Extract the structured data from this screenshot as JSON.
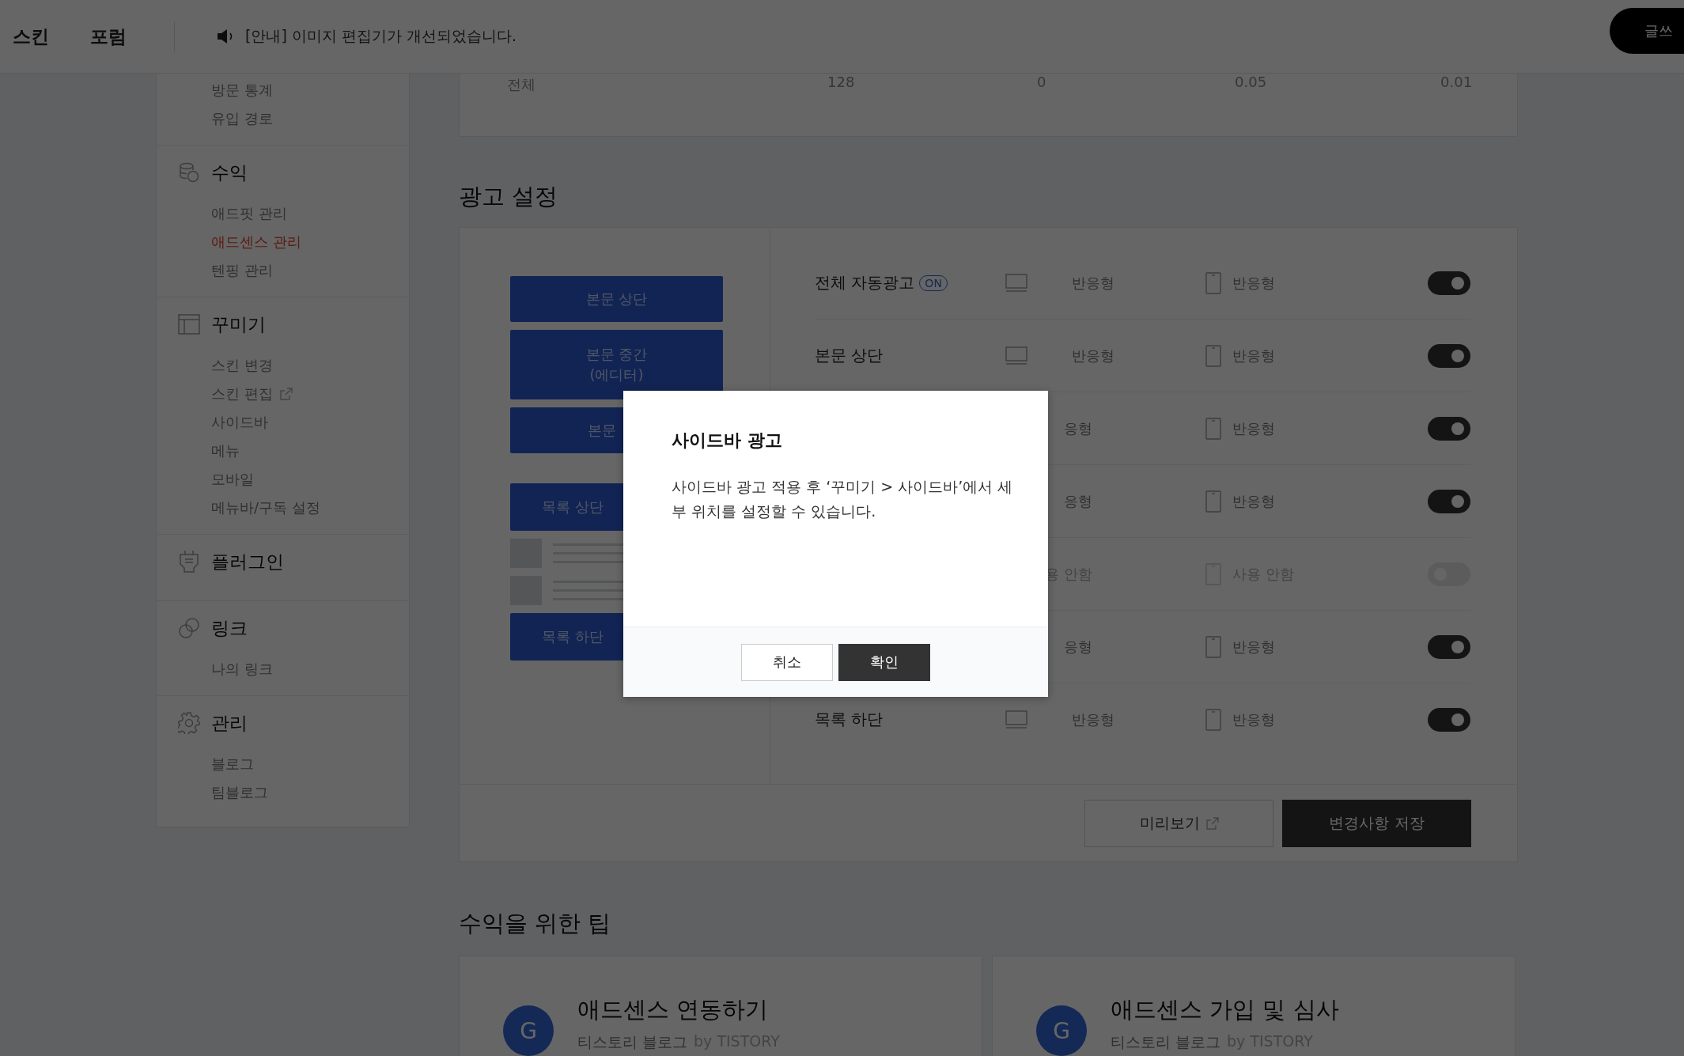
{
  "topbar": {
    "nav": [
      "스킨",
      "포럼"
    ],
    "notice": "[안내] 이미지 편집기가 개선되었습니다.",
    "write_button": "글쓰"
  },
  "sidebar": {
    "sections": [
      {
        "items": [
          {
            "label": "방문 통계",
            "selected": false,
            "external": false
          },
          {
            "label": "유입 경로",
            "selected": false,
            "external": false
          }
        ]
      },
      {
        "kind": "coins",
        "title": "수익",
        "items": [
          {
            "label": "애드핏 관리",
            "selected": false,
            "external": false
          },
          {
            "label": "애드센스 관리",
            "selected": true,
            "external": false
          },
          {
            "label": "텐핑 관리",
            "selected": false,
            "external": false
          }
        ]
      },
      {
        "kind": "layout",
        "title": "꾸미기",
        "items": [
          {
            "label": "스킨 변경",
            "selected": false,
            "external": false
          },
          {
            "label": "스킨 편집",
            "selected": false,
            "external": true
          },
          {
            "label": "사이드바",
            "selected": false,
            "external": false
          },
          {
            "label": "메뉴",
            "selected": false,
            "external": false
          },
          {
            "label": "모바일",
            "selected": false,
            "external": false
          },
          {
            "label": "메뉴바/구독 설정",
            "selected": false,
            "external": false
          }
        ]
      },
      {
        "kind": "plug",
        "title": "플러그인"
      },
      {
        "kind": "link",
        "title": "링크",
        "items": [
          {
            "label": "나의 링크",
            "selected": false,
            "external": false
          }
        ]
      },
      {
        "kind": "gear",
        "title": "관리",
        "items": [
          {
            "label": "블로그",
            "selected": false,
            "external": false
          },
          {
            "label": "팀블로그",
            "selected": false,
            "external": false
          }
        ]
      }
    ]
  },
  "stats": {
    "row": [
      "전체",
      "128",
      "0",
      "0.05",
      "0.01"
    ]
  },
  "ad_settings": {
    "title": "광고 설정",
    "post_slots": [
      [
        "본문 상단"
      ],
      [
        "본문 중간",
        "(에디터)"
      ],
      [
        "본문"
      ]
    ],
    "list_slots": [
      "목록 상단",
      "목록 하단"
    ],
    "rows": [
      {
        "label": "전체 자동광고",
        "badge": "ON",
        "desktop": "반응형",
        "mobile": "반응형",
        "on": true
      },
      {
        "label": "본문 상단",
        "desktop": "반응형",
        "mobile": "반응형",
        "on": true
      },
      {
        "desktop": "응형",
        "mobile": "반응형",
        "on": true
      },
      {
        "desktop": "응형",
        "mobile": "반응형",
        "on": true
      },
      {
        "desktop": "용 안함",
        "mobile": "사용 안함",
        "on": false
      },
      {
        "desktop": "응형",
        "mobile": "반응형",
        "on": true
      },
      {
        "label": "목록 하단",
        "desktop": "반응형",
        "mobile": "반응형",
        "on": true
      }
    ],
    "preview_button": "미리보기",
    "save_button": "변경사항 저장"
  },
  "tips": {
    "title": "수익을 위한 팁",
    "cards": [
      {
        "badge": "G",
        "title": "애드센스 연동하기",
        "source": "티스토리 블로그",
        "by": "by TISTORY"
      },
      {
        "badge": "G",
        "title": "애드센스 가입 및 심사",
        "source": "티스토리 블로그",
        "by": "by TISTORY"
      }
    ]
  },
  "dialog": {
    "title": "사이드바 광고",
    "message": "사이드바 광고 적용 후 ‘꾸미기 > 사이드바’에서 세부 위치를 설정할 수 있습니다.",
    "buttons": [
      {
        "label": "취소",
        "kind": "secondary"
      },
      {
        "label": "확인",
        "kind": "primary"
      }
    ]
  }
}
